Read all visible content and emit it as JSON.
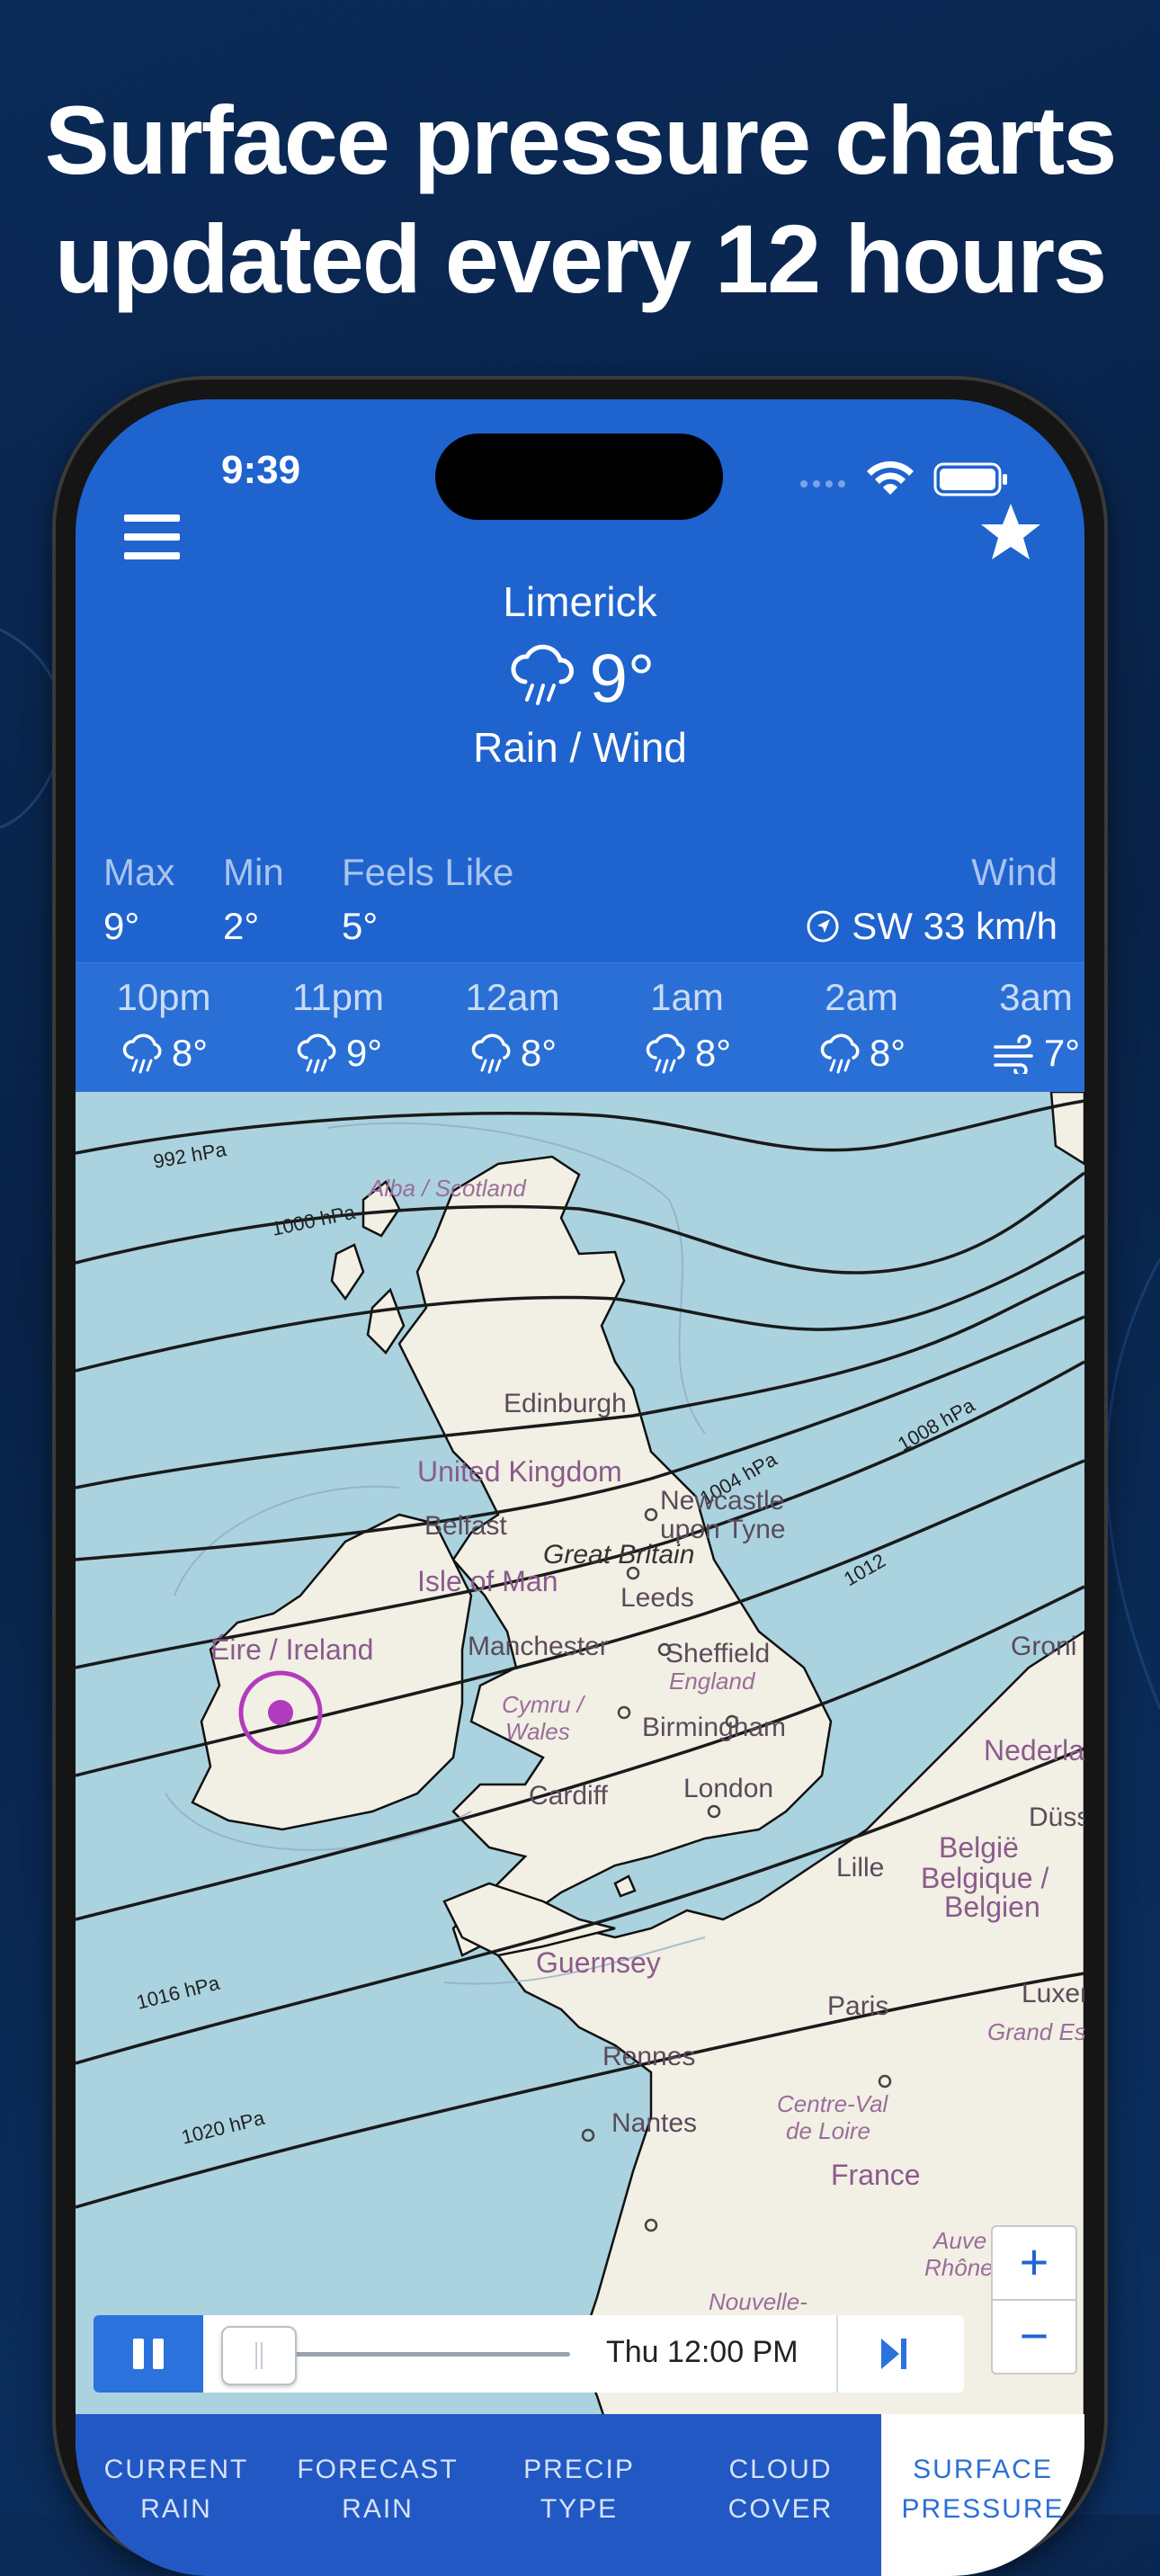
{
  "headline": {
    "line1": "Surface pressure charts",
    "line2": "updated every 12 hours"
  },
  "status_bar": {
    "time": "9:39"
  },
  "header": {
    "location": "Limerick",
    "temperature": "9°",
    "condition": "Rain / Wind",
    "condition_icon": "rain-cloud-icon"
  },
  "stats": {
    "max_label": "Max",
    "max_value": "9°",
    "min_label": "Min",
    "min_value": "2°",
    "feels_label": "Feels Like",
    "feels_value": "5°",
    "wind_label": "Wind",
    "wind_value": "SW 33 km/h"
  },
  "hourly": [
    {
      "time": "10pm",
      "temp": "8°",
      "icon": "rain-cloud-icon"
    },
    {
      "time": "11pm",
      "temp": "9°",
      "icon": "rain-cloud-icon"
    },
    {
      "time": "12am",
      "temp": "8°",
      "icon": "rain-cloud-icon"
    },
    {
      "time": "1am",
      "temp": "8°",
      "icon": "rain-cloud-icon"
    },
    {
      "time": "2am",
      "temp": "8°",
      "icon": "rain-cloud-icon"
    },
    {
      "time": "3am",
      "temp": "7°",
      "icon": "wind-icon"
    }
  ],
  "map": {
    "places": {
      "scotland": "Alba / Scotland",
      "edinburgh": "Edinburgh",
      "uk": "United Kingdom",
      "newcastle1": "Newcastle",
      "newcastle2": "upon Tyne",
      "belfast": "Belfast",
      "great_britain": "Great Britain",
      "isle_of_man": "Isle of Man",
      "leeds": "Leeds",
      "ireland": "Éire / Ireland",
      "manchester": "Manchester",
      "sheffield": "Sheffield",
      "england": "England",
      "wales1": "Cymru /",
      "wales2": "Wales",
      "birmingham": "Birmingham",
      "london": "London",
      "cardiff": "Cardiff",
      "guernsey": "Guernsey",
      "paris": "Paris",
      "rennes": "Rennes",
      "nantes": "Nantes",
      "centre1": "Centre-Val",
      "centre2": "de Loire",
      "france": "France",
      "lille": "Lille",
      "belgie": "België",
      "belgique": "Belgique /",
      "belgien": "Belgien",
      "nederland": "Nederland",
      "luxemb": "Luxemb",
      "grand_est": "Grand Est",
      "groningen": "Groni",
      "dussel": "Düss",
      "nouvelle": "Nouvelle-",
      "auvergne1": "Auve",
      "auvergne2": "Rhône-"
    },
    "isobars": [
      "992 hPa",
      "1000 hPa",
      "1004 hPa",
      "1008 hPa",
      "1012",
      "1016 hPa",
      "1020 hPa"
    ]
  },
  "controls": {
    "zoom_in": "+",
    "zoom_out": "−",
    "timestamp": "Thu 12:00 PM"
  },
  "tabs": [
    {
      "line1": "CURRENT",
      "line2": "RAIN"
    },
    {
      "line1": "FORECAST",
      "line2": "RAIN"
    },
    {
      "line1": "PRECIP",
      "line2": "TYPE"
    },
    {
      "line1": "CLOUD",
      "line2": "COVER"
    },
    {
      "line1": "SURFACE",
      "line2": "PRESSURE"
    }
  ],
  "colors": {
    "header_blue": "#1f63cf",
    "tab_bar": "#2258c4",
    "marker": "#b13bbd",
    "sea": "#aad3df",
    "land": "#f0ecdc"
  }
}
